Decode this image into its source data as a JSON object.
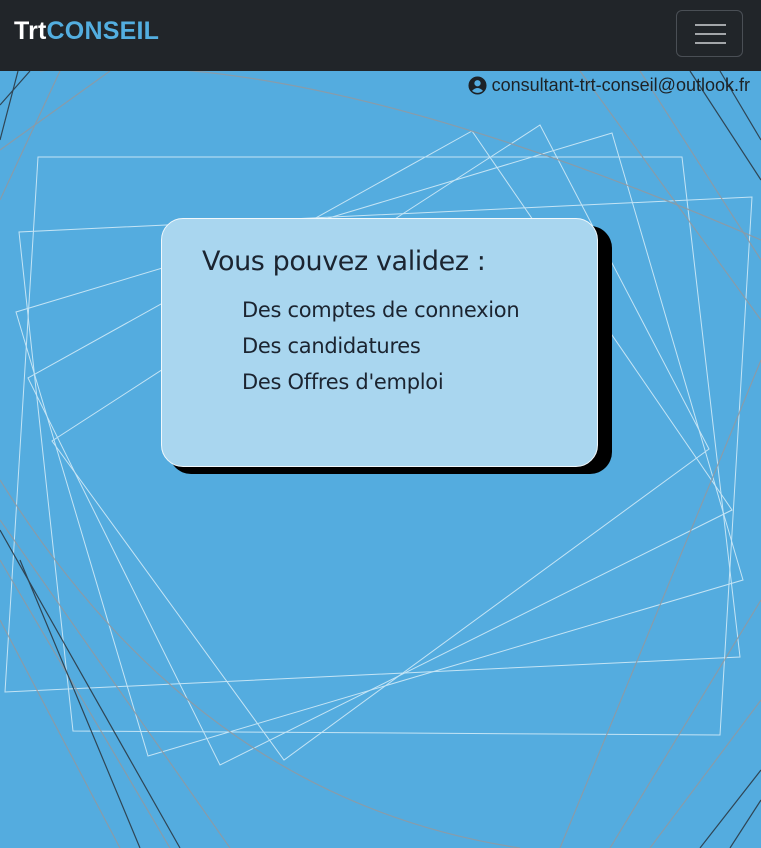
{
  "navbar": {
    "brand_part1": "Trt",
    "brand_part2": "CONSEIL",
    "menu_toggle_icon": "hamburger-icon"
  },
  "user": {
    "icon": "user-circle-icon",
    "email": "consultant-trt-conseil@outlook.fr"
  },
  "card": {
    "title": "Vous pouvez validez :",
    "items": [
      "Des comptes de connexion",
      "Des candidatures",
      "Des Offres d'emploi"
    ]
  },
  "colors": {
    "background": "#54acdf",
    "navbar": "#212529",
    "brand_accent": "#53aee0",
    "card": "#a9d6ef"
  }
}
